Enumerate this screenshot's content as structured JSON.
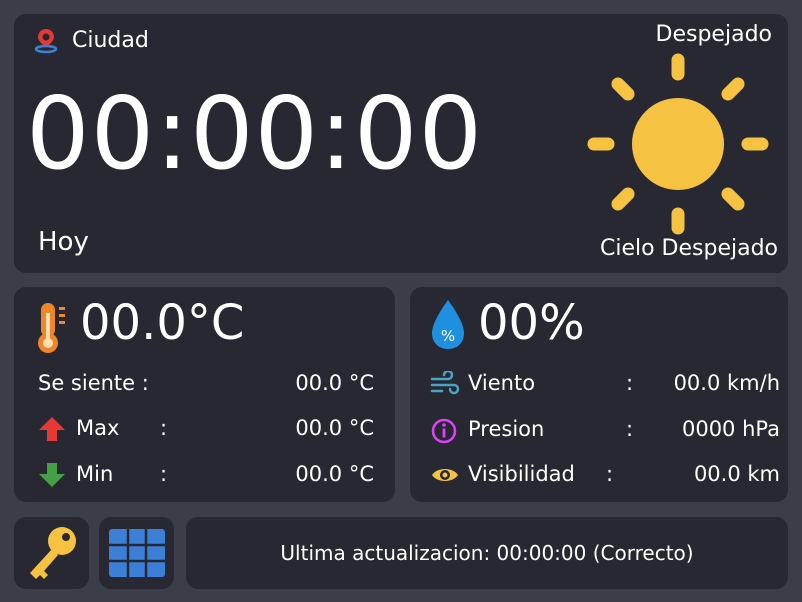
{
  "header": {
    "city": "Ciudad",
    "clock": "00:00:00",
    "day": "Hoy",
    "condition_short": "Despejado",
    "condition_long": "Cielo Despejado"
  },
  "temperature": {
    "value": "00.0°C",
    "feels_label": "Se siente :",
    "feels_value": "00.0 °C",
    "max_label": "Max",
    "max_value": "00.0 °C",
    "min_label": "Min",
    "min_value": "00.0 °C",
    "sep": ":"
  },
  "humidity": {
    "value": "00%",
    "wind_label": "Viento",
    "wind_value": "00.0 km/h",
    "pressure_label": "Presion",
    "pressure_value": "0000 hPa",
    "visibility_label": "Visibilidad",
    "visibility_value": "00.0 km",
    "sep": ":"
  },
  "status": {
    "text": "Ultima actualizacion: 00:00:00 (Correcto)"
  },
  "colors": {
    "background": "#3b3d48",
    "panel": "#272832",
    "sun": "#f5c242",
    "thermo": "#f0862a",
    "drop": "#1f8fe0",
    "up_arrow": "#e53935",
    "down_arrow": "#43a047",
    "pressure": "#e040fb",
    "visibility": "#f5c242",
    "wind": "#4ba3c7",
    "key": "#f5c242",
    "grid": "#3c7fd6"
  },
  "icons": [
    "location-pin-icon",
    "sun-icon",
    "thermometer-icon",
    "arrow-up-icon",
    "arrow-down-icon",
    "humidity-drop-icon",
    "wind-icon",
    "pressure-icon",
    "eye-icon",
    "key-icon",
    "grid-icon"
  ]
}
